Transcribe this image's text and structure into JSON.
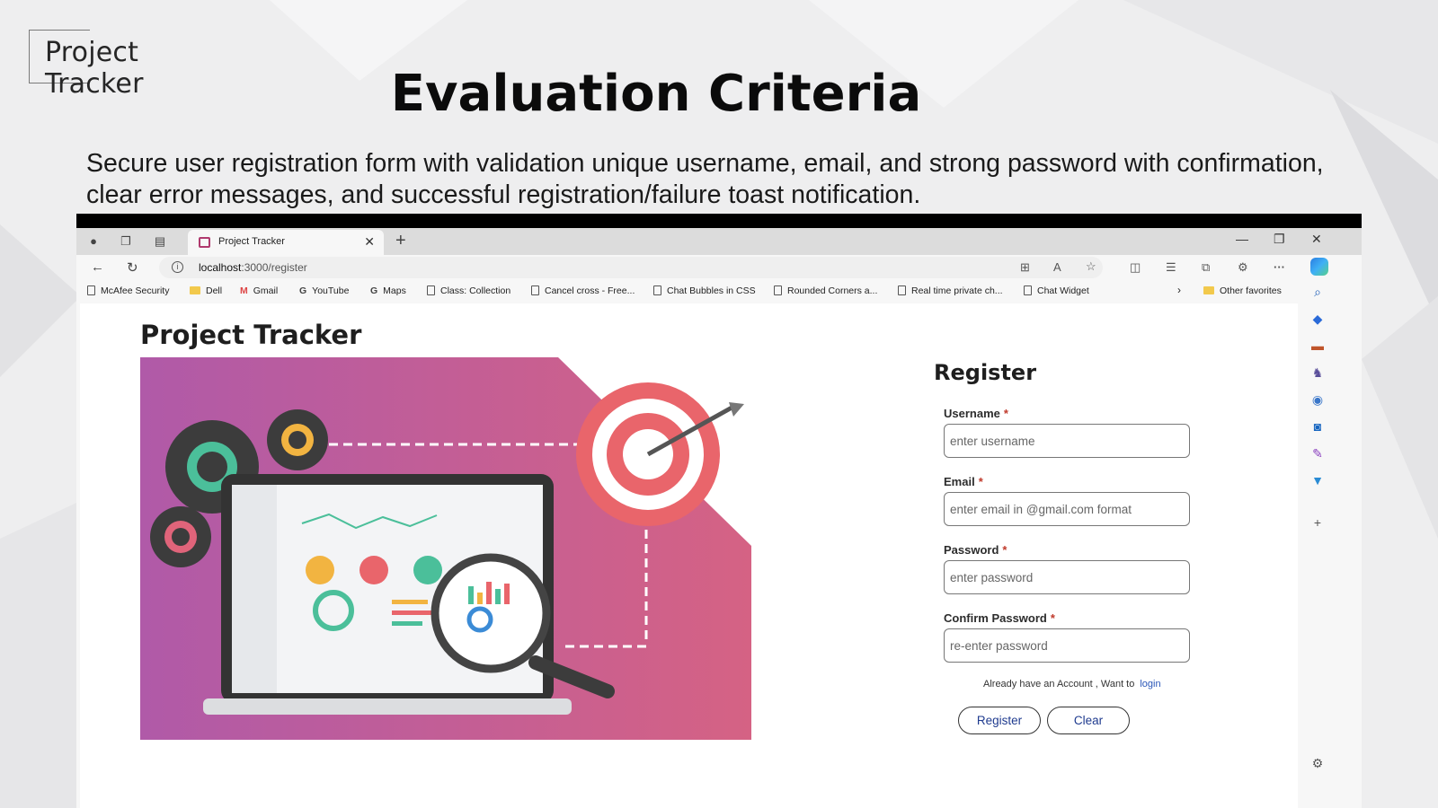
{
  "slide": {
    "logo_text": "Project Tracker",
    "title": "Evaluation Criteria",
    "description": "Secure user registration form with validation unique username, email, and strong password with confirmation, clear error messages, and successful registration/failure toast notification."
  },
  "browser": {
    "tab_title": "Project Tracker",
    "url_host": "localhost",
    "url_path": ":3000/register",
    "favorites": [
      "McAfee Security",
      "Dell",
      "Gmail",
      "YouTube",
      "Maps",
      "Class: Collection",
      "Cancel cross - Free...",
      "Chat Bubbles in CSS",
      "Rounded Corners a...",
      "Real time private ch...",
      "Chat Widget"
    ],
    "other_favorites": "Other favorites"
  },
  "page": {
    "brand": "Project Tracker",
    "form_title": "Register",
    "fields": [
      {
        "label": "Username",
        "required": "*",
        "placeholder": "enter username"
      },
      {
        "label": "Email",
        "required": "*",
        "placeholder": "enter email in @gmail.com format"
      },
      {
        "label": "Password",
        "required": "*",
        "placeholder": "enter password"
      },
      {
        "label": "Confirm Password",
        "required": "*",
        "placeholder": "re-enter password"
      }
    ],
    "login_prompt": "Already have an Account , Want to",
    "login_link": "login",
    "register_button": "Register",
    "clear_button": "Clear"
  },
  "colors": {
    "accent": "#1f3b8f",
    "required": "#c0392b",
    "link": "#2a56b8",
    "hero_gradient_start": "#b05aa8",
    "hero_gradient_end": "#d56284"
  },
  "icons": {
    "sidebar": [
      "search-icon",
      "tag-icon",
      "briefcase-icon",
      "games-icon",
      "office-icon",
      "outlook-icon",
      "designer-icon",
      "drop-icon",
      "add-icon",
      "settings-icon"
    ]
  }
}
